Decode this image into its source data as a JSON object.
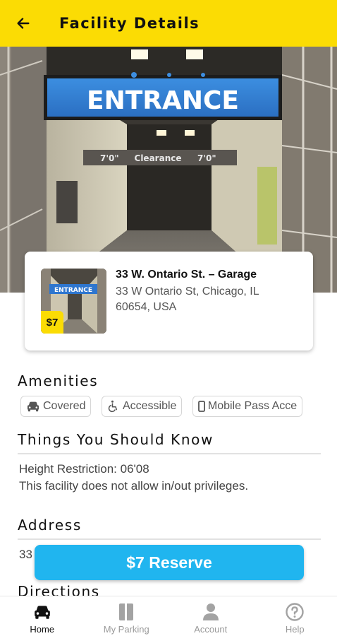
{
  "header": {
    "title": "Facility Details"
  },
  "hero": {
    "sign_text": "ENTRANCE",
    "clearance_left": "7'0\"",
    "clearance_label": "Clearance",
    "clearance_right": "7'0\""
  },
  "facility": {
    "name": "33 W. Ontario St. – Garage",
    "address": "33 W Ontario St, Chicago, IL 60654, USA",
    "price": "$7"
  },
  "amenities": {
    "title": "Amenities",
    "items": [
      "Covered",
      "Accessible",
      "Mobile Pass Acce"
    ]
  },
  "know": {
    "title": "Things You Should Know",
    "lines": [
      "Height Restriction: 06'08",
      "This facility does not allow in/out privileges."
    ]
  },
  "address_section": {
    "title": "Address",
    "partial": "33"
  },
  "directions": {
    "title": "Directions"
  },
  "reserve": {
    "label": "$7 Reserve"
  },
  "nav": {
    "items": [
      {
        "label": "Home",
        "icon": "car-icon",
        "active": true
      },
      {
        "label": "My Parking",
        "icon": "parking-icon",
        "active": false
      },
      {
        "label": "Account",
        "icon": "person-icon",
        "active": false
      },
      {
        "label": "Help",
        "icon": "help-icon",
        "active": false
      }
    ]
  },
  "colors": {
    "brand_yellow": "#fbdc04",
    "accent_blue": "#20b5ef"
  }
}
